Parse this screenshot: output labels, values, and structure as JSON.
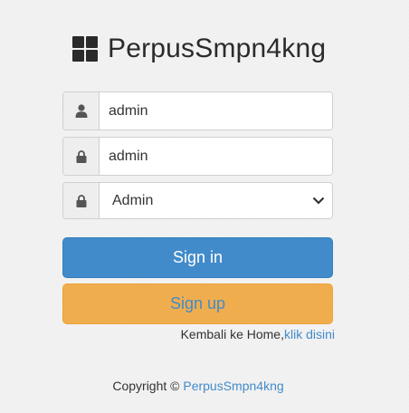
{
  "brand": {
    "title": "PerpusSmpn4kng",
    "icon": "th-large-icon"
  },
  "form": {
    "username": {
      "value": "admin",
      "icon": "user-icon"
    },
    "password": {
      "value": "admin",
      "icon": "lock-icon"
    },
    "role": {
      "selected": "Admin",
      "icon": "lock-icon"
    },
    "signin_label": "Sign in",
    "signup_label": "Sign up"
  },
  "home_link": {
    "text": "Kembali ke Home,",
    "link_label": "klik disini"
  },
  "footer": {
    "copyright": "Copyright ©",
    "brand_link": "PerpusSmpn4kng"
  },
  "colors": {
    "primary": "#428bca",
    "warning": "#f0ad4e"
  }
}
